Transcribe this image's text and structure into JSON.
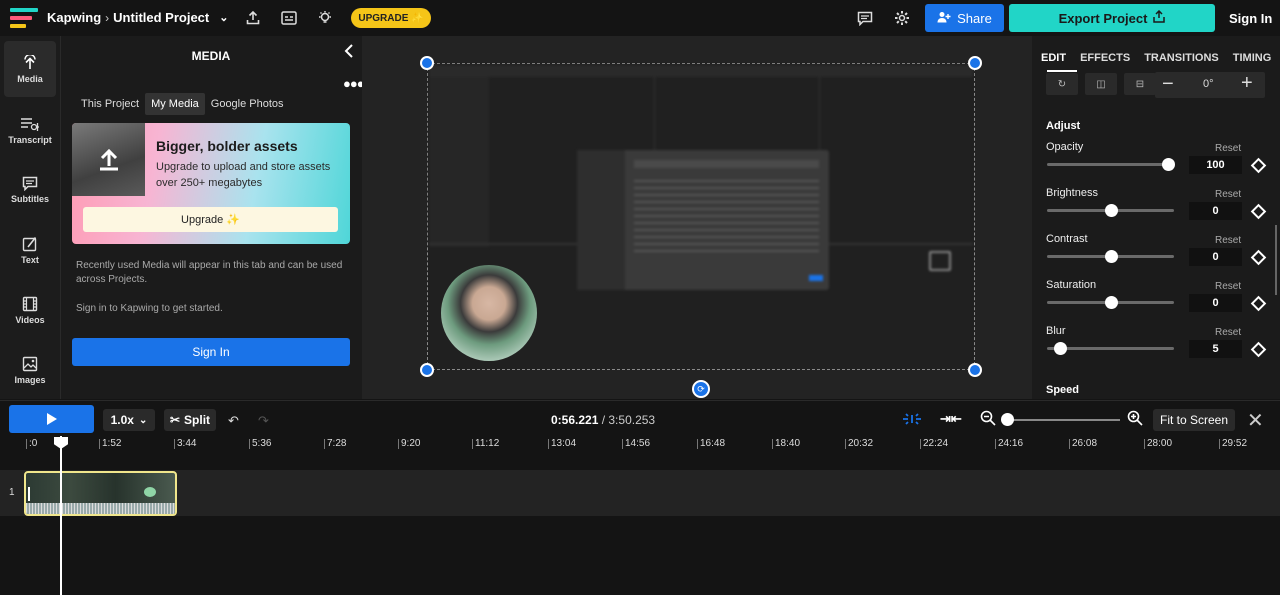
{
  "topbar": {
    "brand": "Kapwing",
    "separator": "›",
    "project_title": "Untitled Project",
    "upgrade_label": "UPGRADE ✨",
    "share_label": "Share",
    "export_label": "Export Project",
    "signin_label": "Sign In",
    "colors": {
      "accent": "#1a73e8",
      "export": "#21d5c7",
      "upgrade": "#f5c518"
    }
  },
  "leftnav": [
    {
      "label": "Media",
      "icon": "upload-icon"
    },
    {
      "label": "Transcript",
      "icon": "transcript-icon"
    },
    {
      "label": "Subtitles",
      "icon": "subtitles-icon"
    },
    {
      "label": "Text",
      "icon": "text-icon"
    },
    {
      "label": "Videos",
      "icon": "film-icon"
    },
    {
      "label": "Images",
      "icon": "image-icon"
    }
  ],
  "media": {
    "title": "MEDIA",
    "tabs": [
      "This Project",
      "My Media",
      "Google Photos"
    ],
    "promo": {
      "title": "Bigger, bolder assets",
      "text": "Upgrade to upload and store assets over 250+ megabytes",
      "button": "Upgrade ✨"
    },
    "info": "Recently used Media will appear in this tab and can be used across Projects.",
    "signin_info": "Sign in to Kapwing to get started.",
    "signin_button": "Sign In"
  },
  "editpanel": {
    "tabs": [
      "EDIT",
      "EFFECTS",
      "TRANSITIONS",
      "TIMING"
    ],
    "rotation": "0°",
    "adjust_label": "Adjust",
    "reset_label": "Reset",
    "adjustments": [
      {
        "label": "Opacity",
        "value": "100",
        "level": 0.95
      },
      {
        "label": "Brightness",
        "value": "0",
        "level": 0.5
      },
      {
        "label": "Contrast",
        "value": "0",
        "level": 0.5
      },
      {
        "label": "Saturation",
        "value": "0",
        "level": 0.5
      },
      {
        "label": "Blur",
        "value": "5",
        "level": 0.1
      }
    ],
    "speed_label": "Speed"
  },
  "timeline": {
    "speed": "1.0x",
    "split_label": "Split",
    "current_time": "0:56.221",
    "total_time": "/ 3:50.253",
    "fit_label": "Fit to Screen",
    "ticks": [
      ":0",
      "1:52",
      "3:44",
      "5:36",
      "7:28",
      "9:20",
      "11:12",
      "13:04",
      "14:56",
      "16:48",
      "18:40",
      "20:32",
      "22:24",
      "24:16",
      "26:08",
      "28:00",
      "29:52"
    ],
    "track_number": "1"
  }
}
